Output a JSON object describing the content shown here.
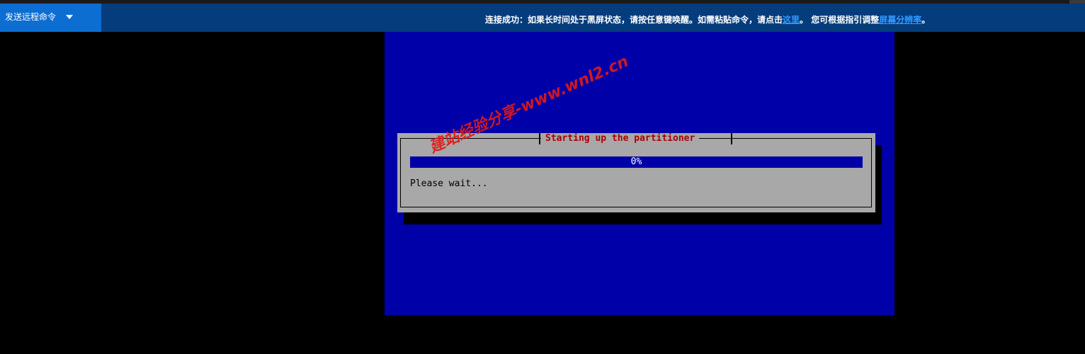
{
  "toolbar": {
    "send_command_label": "发送远程命令",
    "notice_prefix": "连接成功：如果长时间处于黑屏状态，请按任意键唤醒。如需粘贴命令，请点击",
    "notice_link_here": "这里",
    "notice_middle": "。 您可根据指引调整",
    "notice_link_resolution": "屏幕分辨率",
    "notice_suffix": "。"
  },
  "console": {
    "dialog_title": "Starting up the partitioner",
    "progress_label": "0%",
    "progress_value": 0,
    "status_text": "Please wait..."
  },
  "watermark": {
    "text": "建站经验分享-www.wnl2.cn"
  },
  "colors": {
    "topbar": "#053c7c",
    "send_button": "#0d6ed2",
    "link": "#2f9bff",
    "console_bg": "#0000a8",
    "dialog_bg": "#a8a8a8",
    "title_red": "#a80000",
    "watermark_red": "#e01a1a"
  }
}
